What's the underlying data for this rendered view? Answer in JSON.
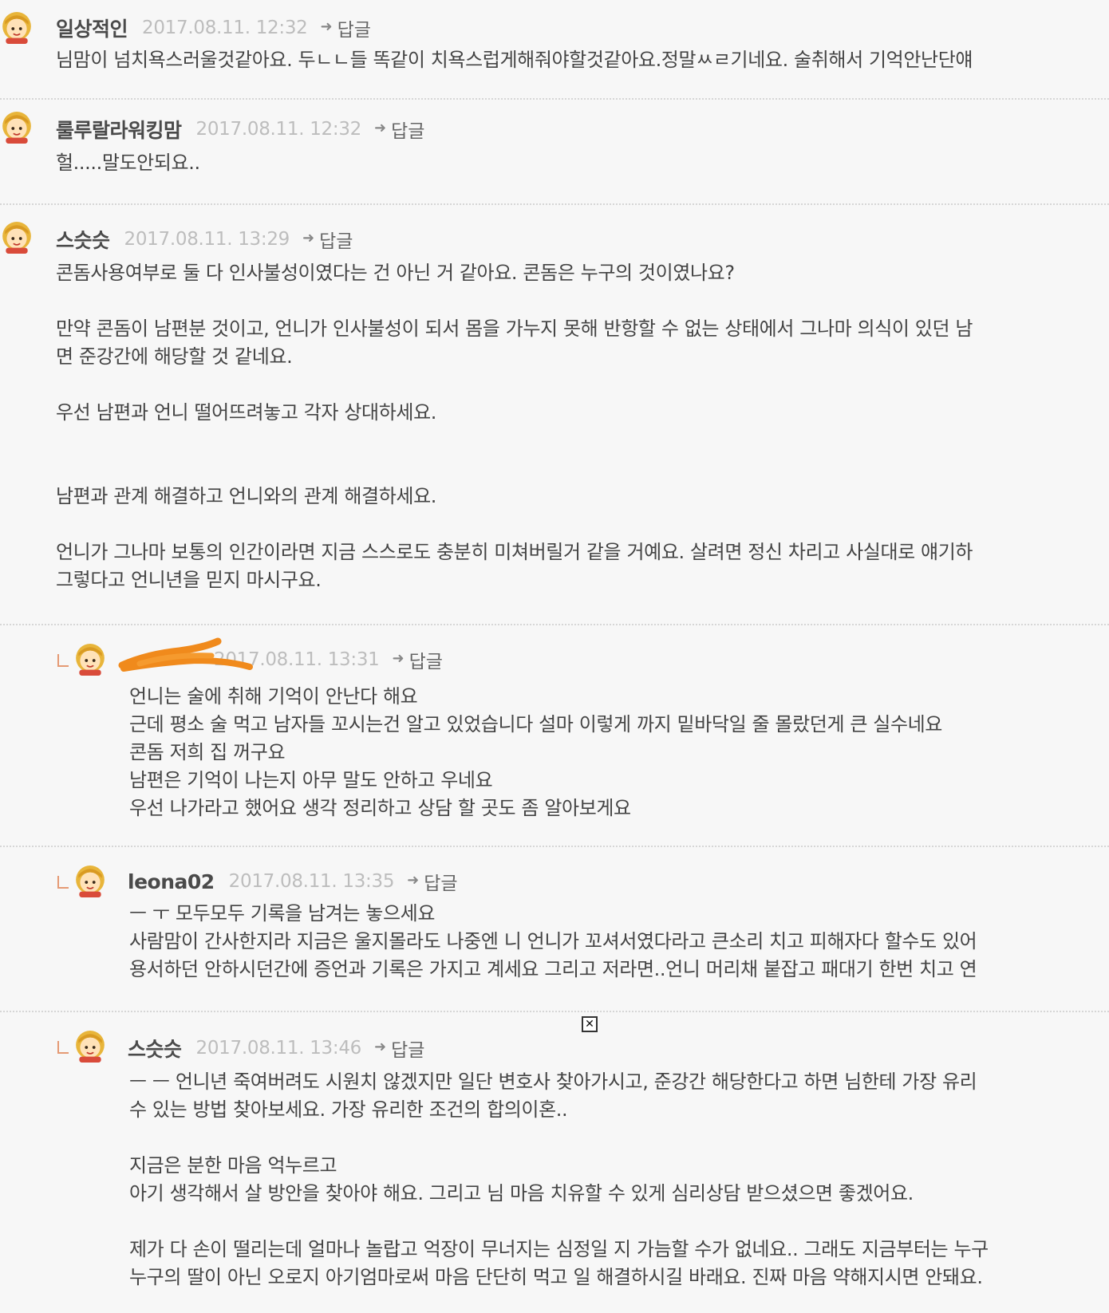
{
  "comments": [
    {
      "nickname": "일상적인",
      "date": "2017.08.11. 12:32",
      "reply_label": "답글",
      "body": "님맘이 넘치욕스러울것같아요. 두ㄴㄴ들 똑같이 치욕스럽게해줘야할것같아요.정말ㅆㄹ기네요. 술취해서 기억안난단얘"
    },
    {
      "nickname": "룰루랄라워킹맘",
      "date": "2017.08.11. 12:32",
      "reply_label": "답글",
      "body": "헐.....말도안되요.."
    },
    {
      "nickname": "스슷슷",
      "date": "2017.08.11. 13:29",
      "reply_label": "답글",
      "body": "콘돔사용여부로 둘 다 인사불성이였다는 건 아닌 거 같아요. 콘돔은 누구의 것이였나요?\n\n만약 콘돔이 남편분 것이고, 언니가 인사불성이 되서 몸을 가누지 못해 반항할 수 없는 상태에서 그나마 의식이 있던 남\n면 준강간에 해당할 것 같네요.\n\n우선 남편과 언니 떨어뜨려놓고 각자 상대하세요.\n\n\n남편과 관계 해결하고 언니와의 관계 해결하세요.\n\n언니가 그나마 보통의 인간이라면 지금 스스로도 충분히 미쳐버릴거 같을 거예요. 살려면 정신 차리고 사실대로 얘기하\n그렇다고 언니년을 믿지 마시구요."
    },
    {
      "nickname": "",
      "date": "2017.08.11. 13:31",
      "reply_label": "답글",
      "body": "언니는 술에 취해 기억이 안난다 해요\n근데 평소 술 먹고 남자들 꼬시는건 알고 있었습니다 설마 이렇게 까지 밑바닥일 줄 몰랐던게 큰 실수네요\n콘돔 저희 집 꺼구요\n남편은 기억이 나는지 아무 말도 안하고 우네요\n우선 나가라고 했어요 생각 정리하고 상담 할 곳도 좀 알아보게요"
    },
    {
      "nickname": "leona02",
      "date": "2017.08.11. 13:35",
      "reply_label": "답글",
      "body": "ㅡ ㅜ 모두모두 기록을 남겨는 놓으세요\n사람맘이 간사한지라 지금은 울지몰라도 나중엔 니 언니가 꼬셔서였다라고 큰소리 치고 피해자다 할수도 있어\n용서하던 안하시던간에 증언과 기록은 가지고 계세요 그리고 저라면..언니 머리채 붙잡고 패대기 한번 치고 연"
    },
    {
      "nickname": "스슷슷",
      "date": "2017.08.11. 13:46",
      "reply_label": "답글",
      "body": "ㅡ ㅡ 언니년 죽여버려도 시원치 않겠지만 일단 변호사 찾아가시고, 준강간 해당한다고 하면 님한테 가장 유리\n수 있는 방법 찾아보세요. 가장 유리한 조건의 합의이혼..\n\n지금은 분한 마음 억누르고\n아기 생각해서 살 방안을 찾아야 해요. 그리고 님 마음 치유할 수 있게 심리상담 받으셨으면 좋겠어요.\n\n제가 다 손이 떨리는데 얼마나 놀랍고 억장이 무너지는 심정일 지 가늠할 수가 없네요.. 그래도 지금부터는 누구\n누구의 딸이 아닌 오로지 아기엄마로써 마음 단단히 먹고 일 해결하시길 바래요. 진짜 마음 약해지시면 안돼요."
    }
  ],
  "icons": {
    "avatar": "blonde-cartoon-avatar-icon",
    "reply": "reply-arrow-icon",
    "close": "close-icon"
  },
  "close_glyph": "✕",
  "colors": {
    "background": "#f7f7f7",
    "text": "#444444",
    "nickname": "#4a4a4a",
    "date": "#bdbdbd",
    "divider": "#d6d6d6",
    "reply_indent": "#e59a74",
    "redaction_scribble": "#f08a1c"
  }
}
